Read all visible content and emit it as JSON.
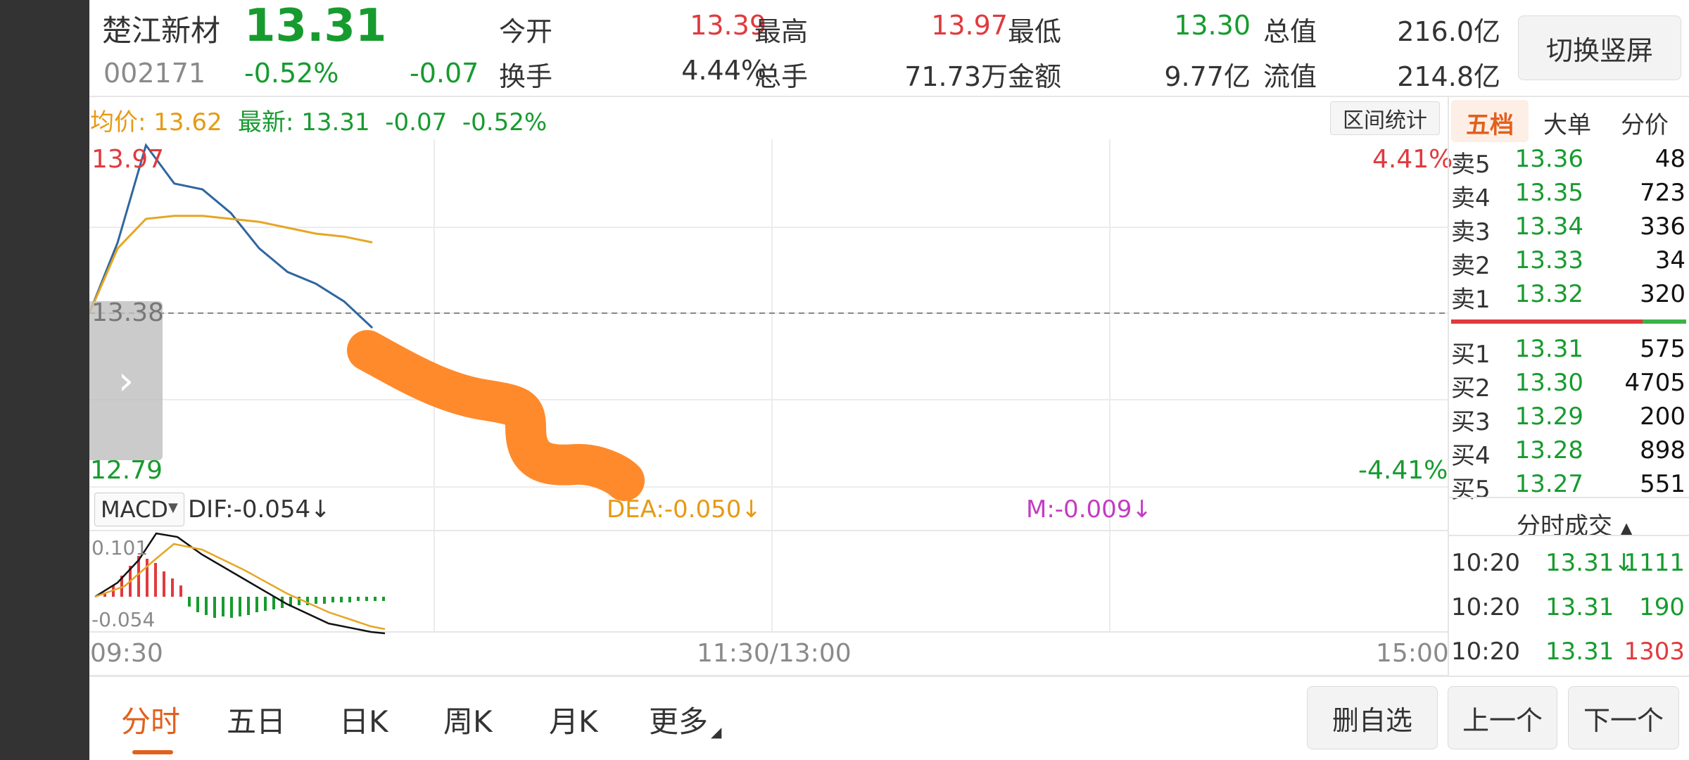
{
  "stock": {
    "name": "楚江新材",
    "price": "13.31",
    "code": "002171",
    "change_pct": "-0.52%",
    "change": "-0.07"
  },
  "stats": [
    {
      "label": "今开",
      "value": "13.39",
      "color": "red"
    },
    {
      "label": "最高",
      "value": "13.97",
      "color": "red"
    },
    {
      "label": "最低",
      "value": "13.30",
      "color": "green"
    },
    {
      "label": "总值",
      "value": "216.0亿",
      "color": "dark"
    },
    {
      "label": "换手",
      "value": "4.44%",
      "color": "dark"
    },
    {
      "label": "总手",
      "value": "71.73万",
      "color": "dark"
    },
    {
      "label": "金额",
      "value": "9.77亿",
      "color": "dark"
    },
    {
      "label": "流值",
      "value": "214.8亿",
      "color": "dark"
    }
  ],
  "switch_btn": "切换竖屏",
  "info": {
    "avg_label": "均价:",
    "avg_value": "13.62",
    "latest_label": "最新:",
    "latest_value": "13.31",
    "latest_change": "-0.07",
    "latest_pct": "-0.52%"
  },
  "interval_btn": "区间统计",
  "chart_labels": {
    "high": "13.97",
    "base": "13.38",
    "low": "12.79",
    "high_pct": "4.41%",
    "low_pct": "-4.41%",
    "t_start": "09:30",
    "t_mid": "11:30/13:00",
    "t_end": "15:00"
  },
  "macd": {
    "selector": "MACD",
    "dif": "DIF:-0.054↓",
    "dea": "DEA:-0.050↓",
    "m": "M:-0.009↓",
    "top": "0.101",
    "bottom": "-0.054"
  },
  "orderbook_tabs": [
    "五档",
    "大单",
    "分价"
  ],
  "sells": [
    {
      "label": "卖5",
      "price": "13.36",
      "vol": "48"
    },
    {
      "label": "卖4",
      "price": "13.35",
      "vol": "723"
    },
    {
      "label": "卖3",
      "price": "13.34",
      "vol": "336"
    },
    {
      "label": "卖2",
      "price": "13.33",
      "vol": "34"
    },
    {
      "label": "卖1",
      "price": "13.32",
      "vol": "320"
    }
  ],
  "buys": [
    {
      "label": "买1",
      "price": "13.31",
      "vol": "575"
    },
    {
      "label": "买2",
      "price": "13.30",
      "vol": "4705"
    },
    {
      "label": "买3",
      "price": "13.29",
      "vol": "200"
    },
    {
      "label": "买4",
      "price": "13.28",
      "vol": "898"
    },
    {
      "label": "买5",
      "price": "13.27",
      "vol": "551"
    }
  ],
  "trades_header": "分时成交",
  "trades": [
    {
      "time": "10:20",
      "price": "13.31↓",
      "vol": "1111",
      "vol_color": "green"
    },
    {
      "time": "10:20",
      "price": "13.31",
      "vol": "190",
      "vol_color": "green"
    },
    {
      "time": "10:20",
      "price": "13.31",
      "vol": "1303",
      "vol_color": "red"
    }
  ],
  "bottom_tabs": [
    "分时",
    "五日",
    "日K",
    "周K",
    "月K",
    "更多"
  ],
  "bottom_buttons": {
    "delete": "删自选",
    "prev": "上一个",
    "next": "下一个"
  },
  "colors": {
    "price_line": "#2f66a0",
    "avg_line": "#e6a623",
    "up": "#e03a3e",
    "down": "#179b2f",
    "active_tab": "#e0611d",
    "annotation": "#ff8a2b"
  },
  "chart_data": {
    "type": "line",
    "x_range": [
      "09:30",
      "15:00"
    ],
    "ylim": [
      12.79,
      13.97
    ],
    "reference": 13.38,
    "series": [
      {
        "x": [
          "09:30",
          "09:35",
          "09:40",
          "09:45",
          "09:50",
          "09:55",
          "10:00",
          "10:05",
          "10:10",
          "10:15",
          "10:20"
        ],
        "values": [
          13.38,
          13.62,
          13.95,
          13.82,
          13.8,
          13.72,
          13.6,
          13.52,
          13.48,
          13.42,
          13.33
        ]
      },
      {
        "x": [
          "09:30",
          "09:35",
          "09:40",
          "09:45",
          "09:50",
          "09:55",
          "10:00",
          "10:05",
          "10:10",
          "10:15",
          "10:20"
        ],
        "values": [
          13.38,
          13.6,
          13.7,
          13.71,
          13.71,
          13.7,
          13.69,
          13.67,
          13.65,
          13.64,
          13.62
        ]
      }
    ]
  }
}
